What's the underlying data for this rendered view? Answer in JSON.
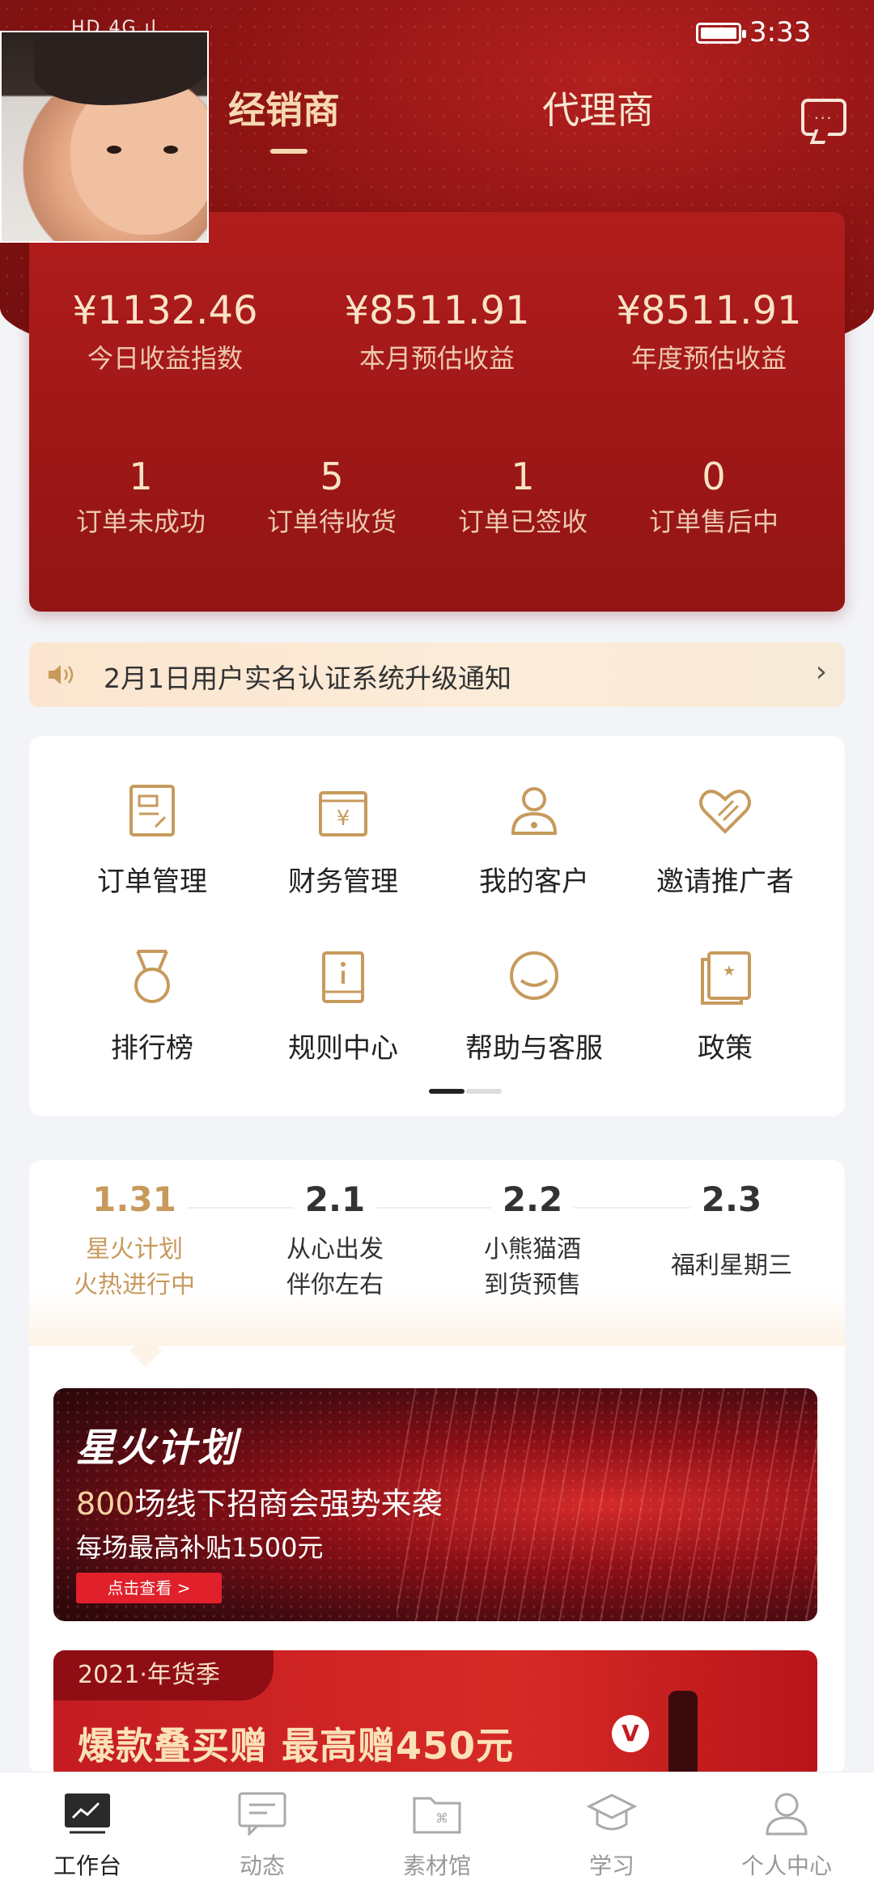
{
  "status_bar": {
    "left_indicators": "HD 4G ıl",
    "time": "3:33"
  },
  "header": {
    "tabs": [
      {
        "label": "经销商",
        "active": true
      },
      {
        "label": "代理商",
        "active": false
      }
    ]
  },
  "stats": {
    "earnings": [
      {
        "value": "¥1132.46",
        "label": "今日收益指数"
      },
      {
        "value": "¥8511.91",
        "label": "本月预估收益"
      },
      {
        "value": "¥8511.91",
        "label": "年度预估收益"
      }
    ],
    "orders": [
      {
        "value": "1",
        "label": "订单未成功"
      },
      {
        "value": "5",
        "label": "订单待收货"
      },
      {
        "value": "1",
        "label": "订单已签收"
      },
      {
        "value": "0",
        "label": "订单售后中"
      }
    ]
  },
  "notice": {
    "text": "2月1日用户实名认证系统升级通知",
    "arrow": "›"
  },
  "functions": [
    {
      "label": "订单管理",
      "icon": "order-doc-icon"
    },
    {
      "label": "财务管理",
      "icon": "finance-yen-icon"
    },
    {
      "label": "我的客户",
      "icon": "customer-person-icon"
    },
    {
      "label": "邀请推广者",
      "icon": "invite-heart-icon"
    },
    {
      "label": "排行榜",
      "icon": "medal-icon"
    },
    {
      "label": "规则中心",
      "icon": "rules-book-icon"
    },
    {
      "label": "帮助与客服",
      "icon": "help-chat-icon"
    },
    {
      "label": "政策",
      "icon": "policy-star-icon"
    }
  ],
  "timeline": [
    {
      "date": "1.31",
      "title_line1": "星火计划",
      "title_line2": "火热进行中",
      "active": true
    },
    {
      "date": "2.1",
      "title_line1": "从心出发",
      "title_line2": "伴你左右",
      "active": false
    },
    {
      "date": "2.2",
      "title_line1": "小熊猫酒",
      "title_line2": "到货预售",
      "active": false
    },
    {
      "date": "2.3",
      "title_line1": "福利星期三",
      "title_line2": "",
      "active": false
    }
  ],
  "banner1": {
    "logo": "星火计划",
    "line1_highlight": "800",
    "line1_rest": "场线下招商会强势来袭",
    "line2": "每场最高补贴1500元",
    "button": "点击查看 >"
  },
  "banner2": {
    "tag": "2021·年货季",
    "title": "爆款叠买赠 最高赠450元",
    "badge": "V"
  },
  "bottom_nav": [
    {
      "label": "工作台",
      "icon": "workbench-chart-icon",
      "active": true
    },
    {
      "label": "动态",
      "icon": "feed-message-icon",
      "active": false
    },
    {
      "label": "素材馆",
      "icon": "material-folder-icon",
      "active": false
    },
    {
      "label": "学习",
      "icon": "study-cap-icon",
      "active": false
    },
    {
      "label": "个人中心",
      "icon": "profile-person-icon",
      "active": false
    }
  ],
  "colors": {
    "brand_red": "#a11818",
    "gold": "#c79a5c",
    "gold_light": "#f8e3c6"
  }
}
